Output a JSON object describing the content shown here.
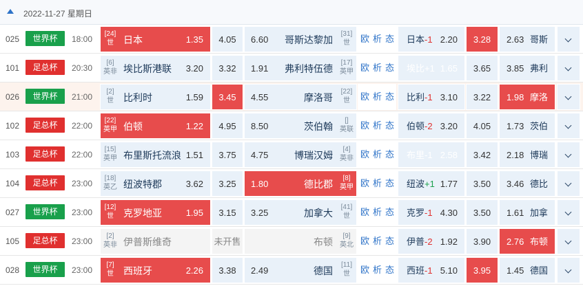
{
  "header": {
    "date": "2022-11-27  星期日"
  },
  "links": [
    "欧",
    "析",
    "态"
  ],
  "matches": [
    {
      "num": "025",
      "league": "世界杯",
      "lc": "wc",
      "time": "18:00",
      "home": {
        "rank": "[24]",
        "tag": "世",
        "name": "日本",
        "odds": "1.35",
        "red": true
      },
      "draw": {
        "odds": "4.05",
        "red": false
      },
      "away": {
        "rank": "[31]",
        "tag": "世",
        "name": "哥斯达黎加",
        "odds": "6.60",
        "red": false
      },
      "lhome": {
        "name": "日本",
        "hc": "-1",
        "odds": "2.20",
        "red": false
      },
      "ldraw": {
        "odds": "3.28",
        "red": true
      },
      "laway": {
        "odds": "2.63",
        "name": "哥斯",
        "red": false
      }
    },
    {
      "num": "101",
      "league": "足总杯",
      "lc": "fz",
      "time": "20:30",
      "home": {
        "rank": "[6]",
        "tag": "英非",
        "name": "埃比斯港联",
        "odds": "3.20",
        "red": false
      },
      "draw": {
        "odds": "3.32",
        "red": false
      },
      "away": {
        "rank": "[17]",
        "tag": "英甲",
        "name": "弗利特伍德",
        "odds": "1.91",
        "red": false
      },
      "lhome": {
        "name": "埃比",
        "hc": "+1",
        "odds": "1.65",
        "red": true
      },
      "ldraw": {
        "odds": "3.65",
        "red": false
      },
      "laway": {
        "odds": "3.85",
        "name": "弗利",
        "red": false
      }
    },
    {
      "num": "026",
      "league": "世界杯",
      "lc": "wc",
      "time": "21:00",
      "alt": true,
      "home": {
        "rank": "[2]",
        "tag": "世",
        "name": "比利时",
        "odds": "1.59",
        "red": false
      },
      "draw": {
        "odds": "3.45",
        "red": true
      },
      "away": {
        "rank": "[22]",
        "tag": "世",
        "name": "摩洛哥",
        "odds": "4.55",
        "red": false
      },
      "lhome": {
        "name": "比利",
        "hc": "-1",
        "odds": "3.10",
        "red": false
      },
      "ldraw": {
        "odds": "3.22",
        "red": false
      },
      "laway": {
        "odds": "1.98",
        "name": "摩洛",
        "red": true
      }
    },
    {
      "num": "102",
      "league": "足总杯",
      "lc": "fz",
      "time": "22:00",
      "home": {
        "rank": "[22]",
        "tag": "英甲",
        "name": "伯顿",
        "odds": "1.22",
        "red": true
      },
      "draw": {
        "odds": "4.95",
        "red": false
      },
      "away": {
        "rank": "[]",
        "tag": "英联",
        "name": "茨伯翰",
        "odds": "8.50",
        "red": false
      },
      "lhome": {
        "name": "伯顿",
        "hc": "-2",
        "odds": "3.20",
        "red": false
      },
      "ldraw": {
        "odds": "4.05",
        "red": false
      },
      "laway": {
        "odds": "1.73",
        "name": "茨伯",
        "red": false
      }
    },
    {
      "num": "103",
      "league": "足总杯",
      "lc": "fz",
      "time": "22:00",
      "home": {
        "rank": "[15]",
        "tag": "英甲",
        "name": "布里斯托流浪",
        "odds": "1.51",
        "red": false
      },
      "draw": {
        "odds": "3.75",
        "red": false
      },
      "away": {
        "rank": "[4]",
        "tag": "英非",
        "name": "博瑞汉姆",
        "odds": "4.75",
        "red": false
      },
      "lhome": {
        "name": "布里",
        "hc": "-1",
        "odds": "2.58",
        "red": true
      },
      "ldraw": {
        "odds": "3.42",
        "red": false
      },
      "laway": {
        "odds": "2.18",
        "name": "博瑞",
        "red": false
      }
    },
    {
      "num": "104",
      "league": "足总杯",
      "lc": "fz",
      "time": "23:00",
      "home": {
        "rank": "[18]",
        "tag": "英乙",
        "name": "纽波特郡",
        "odds": "3.62",
        "red": false
      },
      "draw": {
        "odds": "3.25",
        "red": false
      },
      "away": {
        "rank": "[8]",
        "tag": "英甲",
        "name": "德比郡",
        "odds": "1.80",
        "red": true
      },
      "lhome": {
        "name": "纽波",
        "hc": "+1",
        "odds": "1.77",
        "red": false
      },
      "ldraw": {
        "odds": "3.50",
        "red": false
      },
      "laway": {
        "odds": "3.46",
        "name": "德比",
        "red": false
      }
    },
    {
      "num": "027",
      "league": "世界杯",
      "lc": "wc",
      "time": "23:00",
      "home": {
        "rank": "[12]",
        "tag": "世",
        "name": "克罗地亚",
        "odds": "1.95",
        "red": true
      },
      "draw": {
        "odds": "3.15",
        "red": false
      },
      "away": {
        "rank": "[41]",
        "tag": "世",
        "name": "加拿大",
        "odds": "3.25",
        "red": false
      },
      "lhome": {
        "name": "克罗",
        "hc": "-1",
        "odds": "4.30",
        "red": false
      },
      "ldraw": {
        "odds": "3.50",
        "red": false
      },
      "laway": {
        "odds": "1.61",
        "name": "加拿",
        "red": false
      }
    },
    {
      "num": "105",
      "league": "足总杯",
      "lc": "fz",
      "time": "23:00",
      "na": true,
      "home": {
        "rank": "[2]",
        "tag": "英非",
        "name": "伊普斯维奇",
        "odds": "",
        "red": false
      },
      "draw": {
        "odds": "未开售",
        "red": false
      },
      "away": {
        "rank": "[9]",
        "tag": "英北",
        "name": "布顿",
        "odds": "",
        "red": false
      },
      "lhome": {
        "name": "伊普",
        "hc": "-2",
        "odds": "1.92",
        "red": false
      },
      "ldraw": {
        "odds": "3.90",
        "red": false
      },
      "laway": {
        "odds": "2.76",
        "name": "布顿",
        "red": true
      }
    },
    {
      "num": "028",
      "league": "世界杯",
      "lc": "wc",
      "time": "23:00",
      "home": {
        "rank": "[7]",
        "tag": "世",
        "name": "西班牙",
        "odds": "2.26",
        "red": true
      },
      "draw": {
        "odds": "3.38",
        "red": false
      },
      "away": {
        "rank": "[11]",
        "tag": "世",
        "name": "德国",
        "odds": "2.49",
        "red": false
      },
      "lhome": {
        "name": "西班",
        "hc": "-1",
        "odds": "5.10",
        "red": false
      },
      "ldraw": {
        "odds": "3.95",
        "red": true
      },
      "laway": {
        "odds": "1.45",
        "name": "德国",
        "red": false
      }
    }
  ]
}
